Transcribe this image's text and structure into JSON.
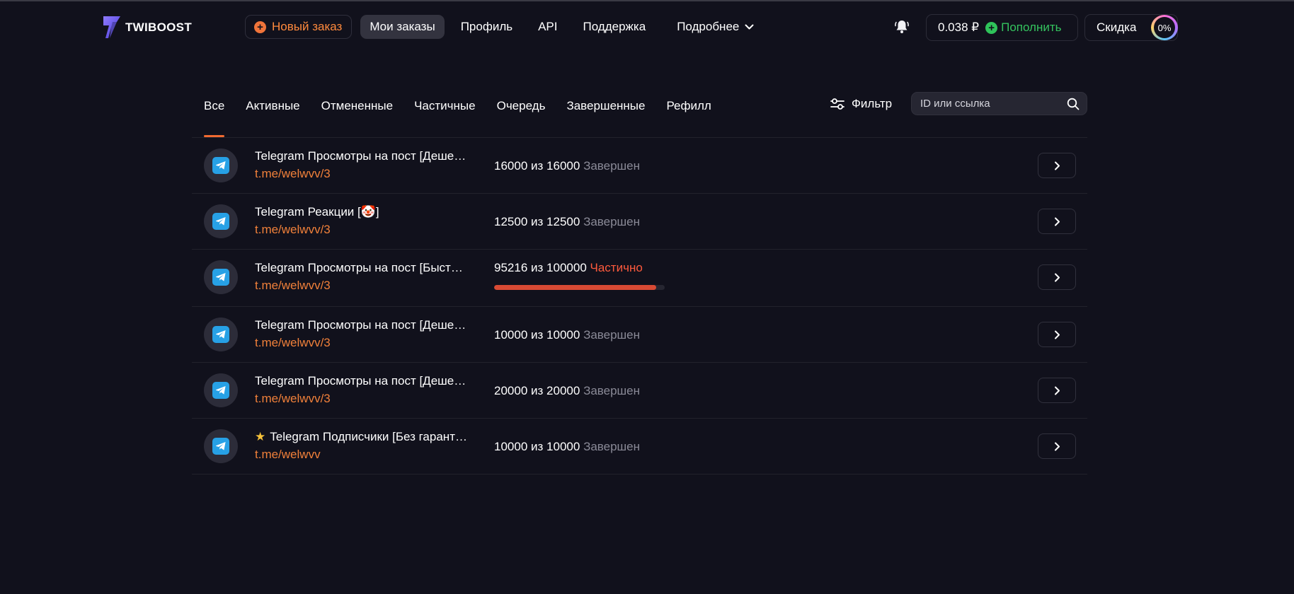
{
  "header": {
    "logo_text": "TWIBOOST",
    "nav": {
      "new_order": "Новый заказ",
      "my_orders": "Мои заказы",
      "profile": "Профиль",
      "api": "API",
      "support": "Поддержка",
      "more": "Подробнее"
    },
    "balance": "0.038 ₽",
    "topup": "Пополнить",
    "discount_label": "Скидка",
    "discount_value": "0%"
  },
  "tabs": [
    {
      "label": "Все",
      "active": true
    },
    {
      "label": "Активные"
    },
    {
      "label": "Отмененные"
    },
    {
      "label": "Частичные"
    },
    {
      "label": "Очередь"
    },
    {
      "label": "Завершенные"
    },
    {
      "label": "Рефилл"
    }
  ],
  "filter_label": "Фильтр",
  "search": {
    "placeholder": "ID или ссылка"
  },
  "orders": [
    {
      "service": "Telegram Просмотры на пост [Дешевые]",
      "link": "t.me/welwvv/3",
      "done": "16000",
      "sep": "из",
      "total": "16000",
      "status": "Завершен"
    },
    {
      "service": "Telegram Реакции [🤡]",
      "link": "t.me/welwvv/3",
      "done": "12500",
      "sep": "из",
      "total": "12500",
      "status": "Завершен"
    },
    {
      "service": "Telegram Просмотры на пост [Быстрые]",
      "link": "t.me/welwvv/3",
      "done": "95216",
      "sep": "из",
      "total": "100000",
      "status": "Частично",
      "progress": 0.95216
    },
    {
      "service": "Telegram Просмотры на пост [Дешевые]",
      "link": "t.me/welwvv/3",
      "done": "10000",
      "sep": "из",
      "total": "10000",
      "status": "Завершен"
    },
    {
      "service": "Telegram Просмотры на пост [Дешевые]",
      "link": "t.me/welwvv/3",
      "done": "20000",
      "sep": "из",
      "total": "20000",
      "status": "Завершен"
    },
    {
      "service": "Telegram Подписчики [Без гарантии]",
      "link": "t.me/welwvv",
      "done": "10000",
      "sep": "из",
      "total": "10000",
      "status": "Завершен",
      "starred": true
    }
  ],
  "colors": {
    "accent": "#f26a31",
    "success": "#34c35e",
    "partial": "#ff5a3d",
    "telegram": "#27a1e6"
  },
  "icons": {
    "bell": "bell-icon",
    "filter": "sliders-icon",
    "search": "search-icon",
    "open": "chevron-right-icon",
    "service": "telegram-icon",
    "star": "star-icon"
  }
}
